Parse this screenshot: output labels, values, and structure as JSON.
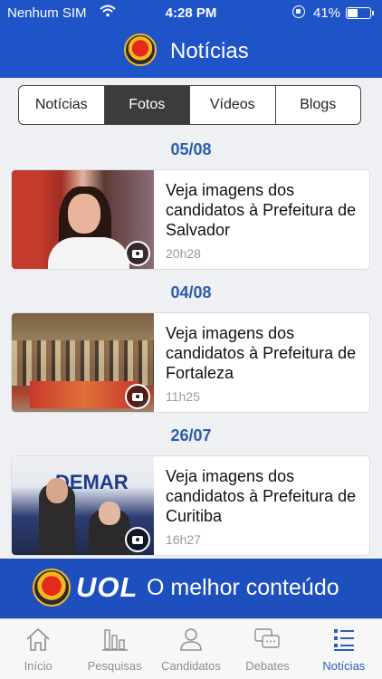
{
  "status_bar": {
    "carrier": "Nenhum SIM",
    "time": "4:28 PM",
    "battery": "41%",
    "battery_level": 0.41
  },
  "header": {
    "title": "Notícias"
  },
  "tabs": [
    {
      "label": "Notícias",
      "active": false
    },
    {
      "label": "Fotos",
      "active": true
    },
    {
      "label": "Vídeos",
      "active": false
    },
    {
      "label": "Blogs",
      "active": false
    }
  ],
  "feed": [
    {
      "date": "05/08",
      "headline": "Veja imagens dos candidatos à Prefeitura de Salvador",
      "time": "20h28"
    },
    {
      "date": "04/08",
      "headline": "Veja imagens dos candidatos à Prefeitura de Fortaleza",
      "time": "11h25"
    },
    {
      "date": "26/07",
      "headline": "Veja imagens dos candidatos à Prefeitura de Curitiba",
      "time": "16h27"
    }
  ],
  "photo_text": {
    "curitiba_banner": "DEMAR"
  },
  "ad_banner": {
    "brand": "UOL",
    "tagline": "O melhor conteúdo"
  },
  "tab_bar": [
    {
      "label": "Início",
      "icon": "home-icon",
      "active": false
    },
    {
      "label": "Pesquisas",
      "icon": "bar-chart-icon",
      "active": false
    },
    {
      "label": "Candidatos",
      "icon": "person-icon",
      "active": false
    },
    {
      "label": "Debates",
      "icon": "chat-bubbles-icon",
      "active": false
    },
    {
      "label": "Notícias",
      "icon": "news-list-icon",
      "active": true
    }
  ],
  "colors": {
    "primary": "#1f54c9",
    "date_accent": "#2d5ea8",
    "active_tab": "#2b5fb9",
    "inactive_tab": "#8f8f8f"
  }
}
